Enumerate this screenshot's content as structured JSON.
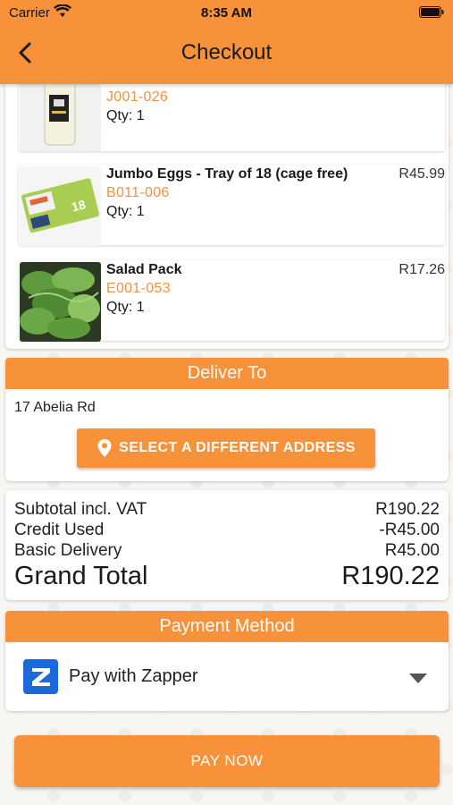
{
  "status_bar": {
    "carrier": "Carrier",
    "time": "8:35 AM"
  },
  "header": {
    "title": "Checkout"
  },
  "items": [
    {
      "name": "",
      "price": "",
      "code": "J001-026",
      "qty": "Qty: 1",
      "image": "milk-bottle"
    },
    {
      "name": "Jumbo Eggs - Tray of 18 (cage free)",
      "price": "R45.99",
      "code": "B011-006",
      "qty": "Qty: 1",
      "image": "egg-tray"
    },
    {
      "name": "Salad Pack",
      "price": "R17.26",
      "code": "E001-053",
      "qty": "Qty: 1",
      "image": "salad-leaves"
    }
  ],
  "delivery": {
    "title": "Deliver To",
    "address": "17 Abelia Rd",
    "change_button": "SELECT A DIFFERENT ADDRESS",
    "button_icon": "location-pin-icon"
  },
  "summary": {
    "subtotal_label": "Subtotal incl. VAT",
    "subtotal_value": "R190.22",
    "credit_label": "Credit Used",
    "credit_value": "-R45.00",
    "delivery_label": "Basic Delivery",
    "delivery_value": "R45.00",
    "grand_label": "Grand Total",
    "grand_value": "R190.22"
  },
  "payment": {
    "title": "Payment Method",
    "selected": "Pay with Zapper",
    "logo_letter": "Z"
  },
  "pay_button": "PAY NOW",
  "colors": {
    "accent": "#f7923a",
    "code_text": "#f2923e",
    "zapper_blue": "#1c6ad9"
  }
}
